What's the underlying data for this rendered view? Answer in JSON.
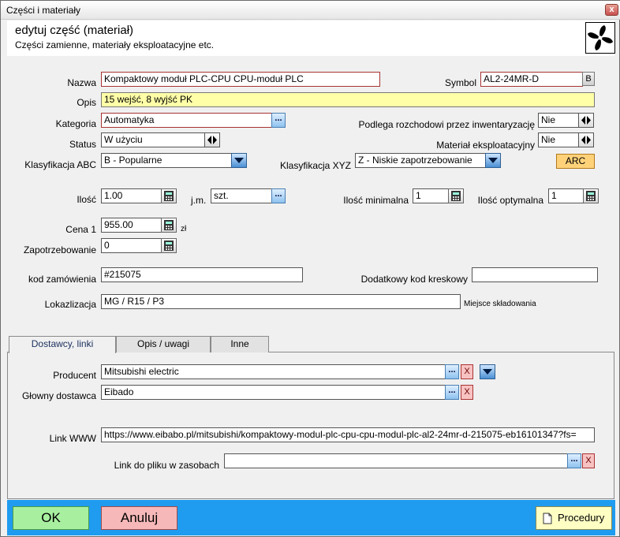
{
  "window": {
    "title": "Części i materiały",
    "close_label": "x"
  },
  "header": {
    "title": "edytuj część (materiał)",
    "subtitle": "Części zamienne, materiały eksploatacyjne etc.",
    "logo_icon": "fan-icon"
  },
  "form": {
    "nazwa": {
      "label": "Nazwa",
      "value": "Kompaktowy moduł PLC-CPU CPU-moduł PLC"
    },
    "symbol": {
      "label": "Symbol",
      "value": "AL2-24MR-D",
      "button": "B"
    },
    "opis": {
      "label": "Opis",
      "value": "15 wejść, 8 wyjść PK"
    },
    "kategoria": {
      "label": "Kategoria",
      "value": "Automatyka",
      "button": "..."
    },
    "rozchod": {
      "label": "Podlega rozchodowi przez inwentaryzację",
      "value": "Nie"
    },
    "status": {
      "label": "Status",
      "value": "W użyciu"
    },
    "eksploatacyjny": {
      "label": "Materiał eksploatacyjny",
      "value": "Nie"
    },
    "abc": {
      "label": "Klasyfikacja ABC",
      "value": "B - Popularne"
    },
    "xyz": {
      "label": "Klasyfikacja XYZ",
      "value": "Z - Niskie zapotrzebowanie"
    },
    "arc_label": "ARC",
    "ilosc": {
      "label": "Ilość",
      "value": "1.00"
    },
    "jm": {
      "label": "j.m.",
      "value": "szt.",
      "button": "..."
    },
    "ilosc_min": {
      "label": "Ilość minimalna",
      "value": "1"
    },
    "ilosc_opt": {
      "label": "Ilość optymalna",
      "value": "1"
    },
    "cena": {
      "label": "Cena 1",
      "value": "955.00",
      "unit": "zł"
    },
    "zapotrzebowanie": {
      "label": "Zapotrzebowanie",
      "value": "0"
    },
    "kod_zam": {
      "label": "kod zamówienia",
      "value": "#215075"
    },
    "kod_kresk": {
      "label": "Dodatkowy kod kreskowy",
      "value": ""
    },
    "lokalizacja": {
      "label": "Lokazlizacja",
      "value": "MG / R15 / P3",
      "hint": "Miejsce składowania"
    }
  },
  "tabs": [
    {
      "label": "Dostawcy, linki",
      "active": true
    },
    {
      "label": "Opis / uwagi",
      "active": false
    },
    {
      "label": "Inne",
      "active": false
    }
  ],
  "suppliers": {
    "producent": {
      "label": "Producent",
      "value": "Mitsubishi electric",
      "dots": "...",
      "clear": "X"
    },
    "dostawca": {
      "label": "Głowny dostawca",
      "value": "Eibado",
      "dots": "...",
      "clear": "X"
    },
    "link": {
      "label": "Link WWW",
      "value": "https://www.eibabo.pl/mitsubishi/kompaktowy-modul-plc-cpu-cpu-modul-plc-al2-24mr-d-215075-eb16101347?fs="
    },
    "plik": {
      "label": "Link do pliku w zasobach",
      "value": "",
      "dots": "...",
      "clear": "X"
    }
  },
  "footer": {
    "ok": "OK",
    "cancel": "Anuluj",
    "procedury": "Procedury"
  },
  "colors": {
    "footer_bg": "#1f9bf0",
    "ok_bg": "#a8f0a0",
    "cancel_bg": "#f6b8b8",
    "arc_bg": "#ffd27a",
    "opis_bg": "#ffffa8"
  }
}
